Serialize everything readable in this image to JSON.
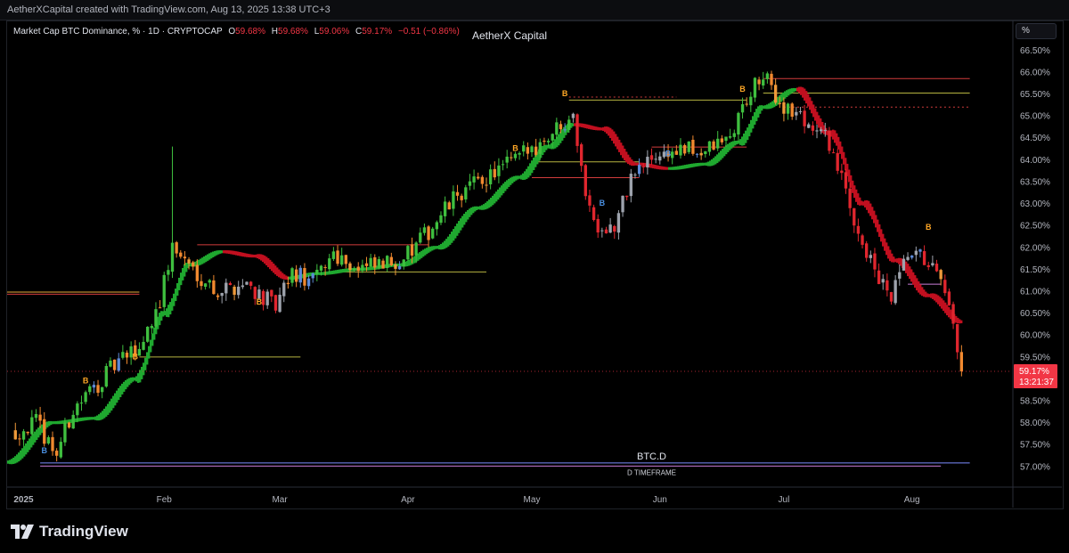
{
  "header": {
    "credit": "AetherXCapital created with TradingView.com, Aug 13, 2025 13:38 UTC+3",
    "symbol": "Market Cap BTC Dominance, % · 1D · CRYPTOCAP",
    "open_label": "O",
    "open": "59.68%",
    "high_label": "H",
    "high": "59.68%",
    "low_label": "L",
    "low": "59.06%",
    "close_label": "C",
    "close": "59.17%",
    "change": "−0.51 (−0.86%)",
    "brand": "AetherX Capital",
    "scale_button": "%"
  },
  "footer": {
    "logo_text": "TradingView"
  },
  "colors": {
    "bull": "#26a69a",
    "bear": "#f23645",
    "ribbon_up": "#1fa82f",
    "ribbon_down": "#c10f1f",
    "price_tag": "#f23645"
  },
  "chart_data": {
    "type": "candlestick",
    "series_name": "BTC.D",
    "timeframe_label": "D TIMEFRAME",
    "y_unit": "%",
    "ylim": [
      56.55,
      66.75
    ],
    "y_ticks": [
      "66.50%",
      "66.00%",
      "65.50%",
      "65.00%",
      "64.50%",
      "64.00%",
      "63.50%",
      "63.00%",
      "62.50%",
      "62.00%",
      "61.50%",
      "61.00%",
      "60.50%",
      "60.00%",
      "59.50%",
      "59.00%",
      "58.50%",
      "58.00%",
      "57.50%",
      "57.00%"
    ],
    "y_tick_values": [
      66.5,
      66.0,
      65.5,
      65.0,
      64.5,
      64.0,
      63.5,
      63.0,
      62.5,
      62.0,
      61.5,
      61.0,
      60.5,
      60.0,
      59.5,
      59.0,
      58.5,
      58.0,
      57.5,
      57.0
    ],
    "x_labels": [
      "2025",
      "Feb",
      "Mar",
      "Apr",
      "May",
      "Jun",
      "Jul",
      "Aug"
    ],
    "last_price": "59.17%",
    "last_price_value": 59.17,
    "countdown": "13:21:37",
    "anchors": [
      [
        "2024-12-27",
        57.8
      ],
      [
        "2025-01-01",
        58.0
      ],
      [
        "2025-01-06",
        57.3
      ],
      [
        "2025-01-10",
        58.3
      ],
      [
        "2025-01-15",
        58.8
      ],
      [
        "2025-01-20",
        59.3
      ],
      [
        "2025-01-26",
        59.7
      ],
      [
        "2025-01-31",
        60.8
      ],
      [
        "2025-02-03",
        62.0
      ],
      [
        "2025-02-07",
        61.6
      ],
      [
        "2025-02-14",
        61.0
      ],
      [
        "2025-02-21",
        61.2
      ],
      [
        "2025-02-28",
        60.6
      ],
      [
        "2025-03-04",
        61.4
      ],
      [
        "2025-03-09",
        61.2
      ],
      [
        "2025-03-14",
        61.9
      ],
      [
        "2025-03-20",
        61.5
      ],
      [
        "2025-03-27",
        61.6
      ],
      [
        "2025-04-02",
        61.9
      ],
      [
        "2025-04-08",
        62.6
      ],
      [
        "2025-04-13",
        63.2
      ],
      [
        "2025-04-20",
        63.6
      ],
      [
        "2025-04-27",
        64.0
      ],
      [
        "2025-05-03",
        64.4
      ],
      [
        "2025-05-09",
        64.9
      ],
      [
        "2025-05-11",
        65.2
      ],
      [
        "2025-05-13",
        63.7
      ],
      [
        "2025-05-16",
        62.6
      ],
      [
        "2025-05-21",
        62.4
      ],
      [
        "2025-05-25",
        63.6
      ],
      [
        "2025-05-31",
        64.1
      ],
      [
        "2025-06-06",
        64.2
      ],
      [
        "2025-06-12",
        64.2
      ],
      [
        "2025-06-18",
        64.5
      ],
      [
        "2025-06-22",
        65.4
      ],
      [
        "2025-06-26",
        65.9
      ],
      [
        "2025-06-30",
        65.3
      ],
      [
        "2025-07-06",
        64.9
      ],
      [
        "2025-07-12",
        64.4
      ],
      [
        "2025-07-17",
        62.9
      ],
      [
        "2025-07-23",
        61.4
      ],
      [
        "2025-07-27",
        60.8
      ],
      [
        "2025-07-31",
        61.8
      ],
      [
        "2025-08-05",
        61.7
      ],
      [
        "2025-08-08",
        61.1
      ],
      [
        "2025-08-11",
        60.2
      ],
      [
        "2025-08-13",
        59.17
      ]
    ],
    "ribbon": [
      [
        "2024-12-25",
        57.1
      ],
      [
        "2025-01-05",
        58.0
      ],
      [
        "2025-01-15",
        58.1
      ],
      [
        "2025-01-25",
        59.0
      ],
      [
        "2025-02-01",
        60.5
      ],
      [
        "2025-02-07",
        61.6
      ],
      [
        "2025-02-15",
        61.9
      ],
      [
        "2025-02-23",
        61.8
      ],
      [
        "2025-03-03",
        61.3
      ],
      [
        "2025-03-10",
        61.4
      ],
      [
        "2025-03-20",
        61.5
      ],
      [
        "2025-03-30",
        61.6
      ],
      [
        "2025-04-08",
        62.0
      ],
      [
        "2025-04-18",
        62.9
      ],
      [
        "2025-04-28",
        63.6
      ],
      [
        "2025-05-05",
        64.3
      ],
      [
        "2025-05-11",
        64.8
      ],
      [
        "2025-05-18",
        64.7
      ],
      [
        "2025-05-26",
        63.9
      ],
      [
        "2025-06-03",
        63.8
      ],
      [
        "2025-06-12",
        63.9
      ],
      [
        "2025-06-20",
        64.4
      ],
      [
        "2025-06-26",
        65.2
      ],
      [
        "2025-07-04",
        65.6
      ],
      [
        "2025-07-12",
        64.6
      ],
      [
        "2025-07-20",
        63.0
      ],
      [
        "2025-07-28",
        61.7
      ],
      [
        "2025-08-05",
        60.9
      ],
      [
        "2025-08-13",
        60.3
      ]
    ],
    "levels": [
      {
        "from": "2024-12-25",
        "to": "2025-01-26",
        "value": 60.98,
        "color": "#e6a83a"
      },
      {
        "from": "2024-12-25",
        "to": "2025-01-26",
        "value": 60.93,
        "color": "#d23c3c"
      },
      {
        "from": "2025-01-26",
        "to": "2025-03-06",
        "value": 59.5,
        "color": "#b5b340"
      },
      {
        "from": "2025-02-09",
        "to": "2025-04-06",
        "value": 62.06,
        "color": "#d23c3c"
      },
      {
        "from": "2025-03-13",
        "to": "2025-04-20",
        "value": 61.44,
        "color": "#b5b340"
      },
      {
        "from": "2025-05-01",
        "to": "2025-05-27",
        "value": 63.95,
        "color": "#b5b340"
      },
      {
        "from": "2025-05-01",
        "to": "2025-05-27",
        "value": 63.59,
        "color": "#d23c3c"
      },
      {
        "from": "2025-05-10",
        "to": "2025-06-22",
        "value": 65.36,
        "color": "#b5b340"
      },
      {
        "from": "2025-05-10",
        "to": "2025-06-05",
        "value": 65.43,
        "color": "#d23c3c",
        "dashed": true
      },
      {
        "from": "2025-05-30",
        "to": "2025-06-22",
        "value": 64.29,
        "color": "#d23c3c"
      },
      {
        "from": "2025-06-26",
        "to": "2025-08-15",
        "value": 65.85,
        "color": "#d23c3c"
      },
      {
        "from": "2025-06-26",
        "to": "2025-08-15",
        "value": 65.52,
        "color": "#b5b340"
      },
      {
        "from": "2025-07-01",
        "to": "2025-08-15",
        "value": 65.2,
        "color": "#d23c3c",
        "dashed": true
      },
      {
        "from": "2025-07-31",
        "to": "2025-08-08",
        "value": 61.16,
        "color": "#c97dd8"
      },
      {
        "from": "2025-01-02",
        "to": "2025-08-15",
        "value": 57.08,
        "color": "#7b8cff"
      },
      {
        "from": "2025-01-02",
        "to": "2025-08-08",
        "value": 57.01,
        "color": "#c97dd8"
      }
    ],
    "markers": [
      {
        "label": "B",
        "date": "2025-01-13",
        "value": 58.9,
        "color": "#ffa726"
      },
      {
        "label": "B",
        "date": "2025-01-25",
        "value": 59.45,
        "color": "#ffa726"
      },
      {
        "label": "B",
        "date": "2025-02-24",
        "value": 60.7,
        "color": "#ffa726"
      },
      {
        "label": "B",
        "date": "2025-04-27",
        "value": 64.2,
        "color": "#ffa726"
      },
      {
        "label": "B",
        "date": "2025-05-09",
        "value": 65.45,
        "color": "#ffa726"
      },
      {
        "label": "B",
        "date": "2025-06-21",
        "value": 65.55,
        "color": "#ffa726"
      },
      {
        "label": "B",
        "date": "2025-08-05",
        "value": 62.4,
        "color": "#ffa726"
      },
      {
        "label": "B",
        "date": "2025-01-03",
        "value": 57.3,
        "color": "#4a90e2"
      },
      {
        "label": "B",
        "date": "2025-05-18",
        "value": 62.95,
        "color": "#4a90e2"
      },
      {
        "label": "B",
        "date": "2025-06-03",
        "value": 64.08,
        "color": "#4a90e2"
      }
    ]
  }
}
